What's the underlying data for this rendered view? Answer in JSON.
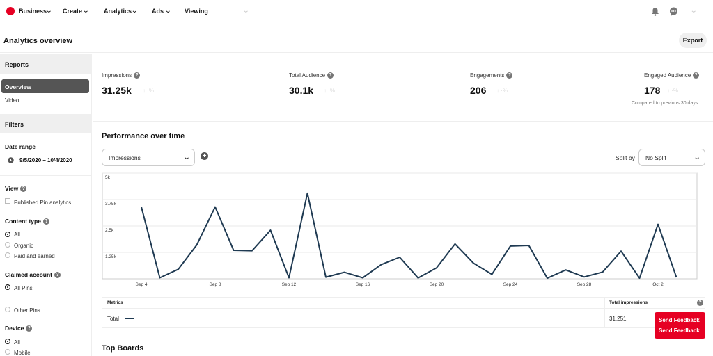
{
  "nav": {
    "business": "Business",
    "create": "Create",
    "analytics": "Analytics",
    "ads": "Ads",
    "viewing": "Viewing"
  },
  "header": {
    "title": "Analytics overview",
    "export_label": "Export"
  },
  "sidebar": {
    "reports_label": "Reports",
    "overview_label": "Overview",
    "video_label": "Video",
    "filters_label": "Filters",
    "date_range_label": "Date range",
    "date_range_value": "9/5/2020 – 10/4/2020",
    "view_label": "View",
    "published_pin_analytics": "Published Pin analytics",
    "content_type_label": "Content type",
    "content_type_options": [
      "All",
      "Organic",
      "Paid and earned"
    ],
    "claimed_account_label": "Claimed account",
    "claimed_account_options": [
      "All Pins",
      "Other Pins"
    ],
    "device_label": "Device",
    "device_options": [
      "All",
      "Mobile"
    ]
  },
  "metrics": [
    {
      "label": "Impressions",
      "value": "31.25k"
    },
    {
      "label": "Total Audience",
      "value": "30.1k"
    },
    {
      "label": "Engagements",
      "value": "206"
    },
    {
      "label": "Engaged Audience",
      "value": "178"
    }
  ],
  "compare_note": "Compared to previous 30 days",
  "performance": {
    "title": "Performance over time",
    "metric_select": "Impressions",
    "split_by_label": "Split by",
    "split_select": "No Split"
  },
  "chart_data": {
    "type": "line",
    "yticks": [
      "5k",
      "3.75k",
      "2.5k",
      "1.25k"
    ],
    "ylim": [
      0,
      5000
    ],
    "xticks": [
      "Sep 4",
      "Sep 8",
      "Sep 12",
      "Sep 16",
      "Sep 20",
      "Sep 24",
      "Sep 28",
      "Oct 2"
    ],
    "x": [
      "Sep 4",
      "Sep 5",
      "Sep 6",
      "Sep 7",
      "Sep 8",
      "Sep 9",
      "Sep 10",
      "Sep 11",
      "Sep 12",
      "Sep 13",
      "Sep 14",
      "Sep 15",
      "Sep 16",
      "Sep 17",
      "Sep 18",
      "Sep 19",
      "Sep 20",
      "Sep 21",
      "Sep 22",
      "Sep 23",
      "Sep 24",
      "Sep 25",
      "Sep 26",
      "Sep 27",
      "Sep 28",
      "Sep 29",
      "Sep 30",
      "Oct 1",
      "Oct 2",
      "Oct 3"
    ],
    "series": [
      {
        "name": "Total",
        "values": [
          3400,
          50,
          450,
          1600,
          3400,
          1350,
          1330,
          2300,
          50,
          4050,
          80,
          310,
          50,
          670,
          1020,
          40,
          520,
          1650,
          740,
          210,
          1550,
          1580,
          30,
          420,
          90,
          320,
          1310,
          30,
          2580,
          70
        ]
      }
    ]
  },
  "table": {
    "metrics_header": "Metrics",
    "total_header": "Total impressions",
    "row_label": "Total",
    "row_value": "31,251"
  },
  "feedback": {
    "line1": "Send Feedback",
    "line2": "Send Feedback"
  },
  "top_boards_label": "Top Boards",
  "colors": {
    "brand": "#e60023",
    "line": "#1f3a52"
  }
}
